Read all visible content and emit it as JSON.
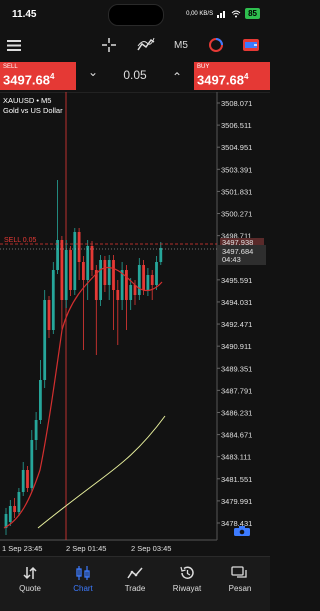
{
  "status": {
    "time": "11.45",
    "speed": "0,00 KB/S",
    "battery": "85"
  },
  "toolbar": {
    "timeframe": "M5"
  },
  "trade": {
    "sell_label": "SELL",
    "sell_price_main": "3497.68",
    "sell_price_sup": "4",
    "buy_label": "BUY",
    "buy_price_main": "3497.68",
    "buy_price_sup": "4",
    "volume": "0.05",
    "minus": "⌄",
    "plus": "⌃"
  },
  "chart": {
    "symbol_line": "XAUUSD • M5",
    "symbol_desc": "Gold vs US Dollar",
    "price_axis": [
      "3508.071",
      "3506.511",
      "3504.951",
      "3503.391",
      "3501.831",
      "3500.271",
      "3498.711",
      "3495.591",
      "3494.031",
      "3492.471",
      "3490.911",
      "3489.351",
      "3487.791",
      "3486.231",
      "3484.671",
      "3483.111",
      "3481.551",
      "3479.991",
      "3478.431"
    ],
    "current_price": "3497.684",
    "countdown": "04:43",
    "prev_price_tag": "3497.938",
    "sell_line_label": "SELL 0.05",
    "time_axis": [
      "1 Sep 23:45",
      "2 Sep 01:45",
      "2 Sep 03:45"
    ],
    "colors": {
      "bull": "#26a69a",
      "bear": "#e53935",
      "ma_red": "#d32f2f",
      "ma_yellow": "#e6ee9c",
      "accent": "#3d7bff"
    }
  },
  "nav": [
    {
      "label": "Quote",
      "icon": "quote-arrows-icon"
    },
    {
      "label": "Chart",
      "icon": "candles-icon",
      "active": true
    },
    {
      "label": "Trade",
      "icon": "trade-line-icon"
    },
    {
      "label": "Riwayat",
      "icon": "history-icon"
    },
    {
      "label": "Pesan",
      "icon": "messages-icon"
    }
  ]
}
